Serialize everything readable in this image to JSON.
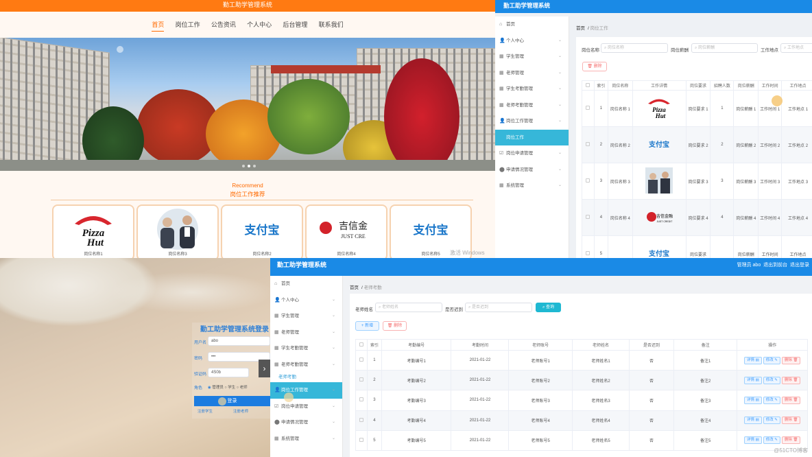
{
  "front": {
    "title": "勤工助学管理系统",
    "nav": [
      "首页",
      "岗位工作",
      "公告资讯",
      "个人中心",
      "后台管理",
      "联系我们"
    ],
    "recommend_en": "Recommend",
    "recommend_cn": "岗位工作推荐",
    "cards": [
      {
        "logo": "Pizza Hut",
        "caption": "岗位名称1"
      },
      {
        "logo": "photo",
        "caption": "岗位名称3"
      },
      {
        "logo": "支付宝",
        "caption": "岗位名称2"
      },
      {
        "logo": "吉信金 JUST CRE",
        "caption": "岗位名称4"
      },
      {
        "logo": "支付宝",
        "caption": "岗位名称5"
      }
    ],
    "watermark": "激活 Windows"
  },
  "adminB": {
    "title": "勤工助学管理系统",
    "menu": [
      {
        "icon": "home-icon",
        "label": "首页",
        "chev": false
      },
      {
        "icon": "user-icon",
        "label": "个人中心",
        "chev": true
      },
      {
        "icon": "list-icon",
        "label": "学生管理",
        "chev": true
      },
      {
        "icon": "list-icon",
        "label": "老师管理",
        "chev": true
      },
      {
        "icon": "list-icon",
        "label": "学生考勤管理",
        "chev": true
      },
      {
        "icon": "list-icon",
        "label": "老师考勤管理",
        "chev": true
      },
      {
        "icon": "user-icon",
        "label": "岗位工作管理",
        "chev": true
      },
      {
        "icon": "",
        "label": "岗位工作",
        "chev": false,
        "selected": true
      },
      {
        "icon": "check-icon",
        "label": "岗位申请管理",
        "chev": true
      },
      {
        "icon": "pin-icon",
        "label": "申请情况管理",
        "chev": true
      },
      {
        "icon": "list-icon",
        "label": "系统管理",
        "chev": true
      }
    ],
    "crumb_home": "首页",
    "crumb_current": "岗位工作",
    "filters": [
      {
        "label": "岗位名称",
        "placeholder": "岗位名称"
      },
      {
        "label": "岗位薪酬",
        "placeholder": "岗位薪酬"
      },
      {
        "label": "工作地点",
        "placeholder": "工作地点"
      }
    ],
    "delete_label": "删除",
    "columns": [
      "",
      "索引",
      "岗位名称",
      "工作详情",
      "岗位要求",
      "招聘人数",
      "岗位薪酬",
      "工作时间",
      "工作地点"
    ],
    "rows": [
      {
        "idx": "1",
        "name": "岗位名称 1",
        "logo": "Pizza Hut",
        "req": "岗位要求 1",
        "num": "1",
        "pay": "岗位薪酬 1",
        "time": "工作时间 1",
        "place": "工作地点 1"
      },
      {
        "idx": "2",
        "name": "岗位名称 2",
        "logo": "支付宝",
        "req": "岗位要求 2",
        "num": "2",
        "pay": "岗位薪酬 2",
        "time": "工作时间 2",
        "place": "工作地点 2"
      },
      {
        "idx": "3",
        "name": "岗位名称 3",
        "logo": "photo",
        "req": "岗位要求 3",
        "num": "3",
        "pay": "岗位薪酬 3",
        "time": "工作时间 3",
        "place": "工作地点 3"
      },
      {
        "idx": "4",
        "name": "岗位名称 4",
        "logo": "吉信金融",
        "req": "岗位要求 4",
        "num": "4",
        "pay": "岗位薪酬 4",
        "time": "工作时间 4",
        "place": "工作地点 4"
      },
      {
        "idx": "5",
        "name": "",
        "logo": "支付宝",
        "req": "岗位要求",
        "num": "",
        "pay": "岗位薪酬",
        "time": "工作时间",
        "place": "工作地点"
      }
    ]
  },
  "login": {
    "title": "勤工助学管理系统登录",
    "user_label": "用户名",
    "user_value": "abo",
    "pass_label": "密码",
    "pass_value": "•••",
    "code_label": "验证码",
    "code_value": "4S0b",
    "role_label": "角色",
    "roles": [
      "管理员",
      "学生",
      "老师"
    ],
    "login_btn": "登录",
    "reg_student": "注册学生",
    "reg_teacher": "注册老师"
  },
  "adminD": {
    "title": "勤工助学管理系统",
    "user": "管理员 abo",
    "exit_front": "退出到前台",
    "logout": "退出登录",
    "menu": [
      {
        "icon": "home-icon",
        "label": "首页",
        "chev": false
      },
      {
        "icon": "user-icon",
        "label": "个人中心",
        "chev": true
      },
      {
        "icon": "list-icon",
        "label": "学生管理",
        "chev": true
      },
      {
        "icon": "list-icon",
        "label": "老师管理",
        "chev": true
      },
      {
        "icon": "list-icon",
        "label": "学生考勤管理",
        "chev": true
      },
      {
        "icon": "list-icon",
        "label": "老师考勤管理",
        "chev": true
      },
      {
        "icon": "",
        "label": "老师考勤",
        "chev": false,
        "plain": true
      },
      {
        "icon": "user-icon",
        "label": "岗位工作管理",
        "chev": true,
        "selected": true
      },
      {
        "icon": "check-icon",
        "label": "岗位申请管理",
        "chev": true
      },
      {
        "icon": "pin-icon",
        "label": "申请情况管理",
        "chev": true
      },
      {
        "icon": "list-icon",
        "label": "系统管理",
        "chev": true
      }
    ],
    "crumb_home": "首页",
    "crumb_current": "老师考勤",
    "filter1_label": "老师姓名",
    "filter1_placeholder": "老师姓名",
    "filter2_label": "是否迟到",
    "filter2_placeholder": "是否迟到",
    "query_label": "查询",
    "add_label": "新增",
    "delete_label": "删除",
    "columns": [
      "",
      "索引",
      "考勤编号",
      "考勤时间",
      "老师账号",
      "老师姓名",
      "是否迟到",
      "备注",
      "操作"
    ],
    "rows": [
      {
        "idx": "1",
        "no": "考勤编号1",
        "date": "2021-01-22",
        "acct": "老师账号1",
        "name": "老师姓名1",
        "late": "否",
        "note": "备注1"
      },
      {
        "idx": "2",
        "no": "考勤编号2",
        "date": "2021-01-22",
        "acct": "老师账号2",
        "name": "老师姓名2",
        "late": "否",
        "note": "备注2"
      },
      {
        "idx": "3",
        "no": "考勤编号3",
        "date": "2021-01-22",
        "acct": "老师账号3",
        "name": "老师姓名3",
        "late": "否",
        "note": "备注3"
      },
      {
        "idx": "4",
        "no": "考勤编号4",
        "date": "2021-01-22",
        "acct": "老师账号4",
        "name": "老师姓名4",
        "late": "否",
        "note": "备注4"
      },
      {
        "idx": "5",
        "no": "考勤编号5",
        "date": "2021-01-22",
        "acct": "老师账号5",
        "name": "老师姓名5",
        "late": "否",
        "note": "备注5"
      }
    ],
    "op_detail": "详情",
    "op_edit": "修改",
    "op_delete": "删除",
    "watermark": "@51CTO博客"
  }
}
